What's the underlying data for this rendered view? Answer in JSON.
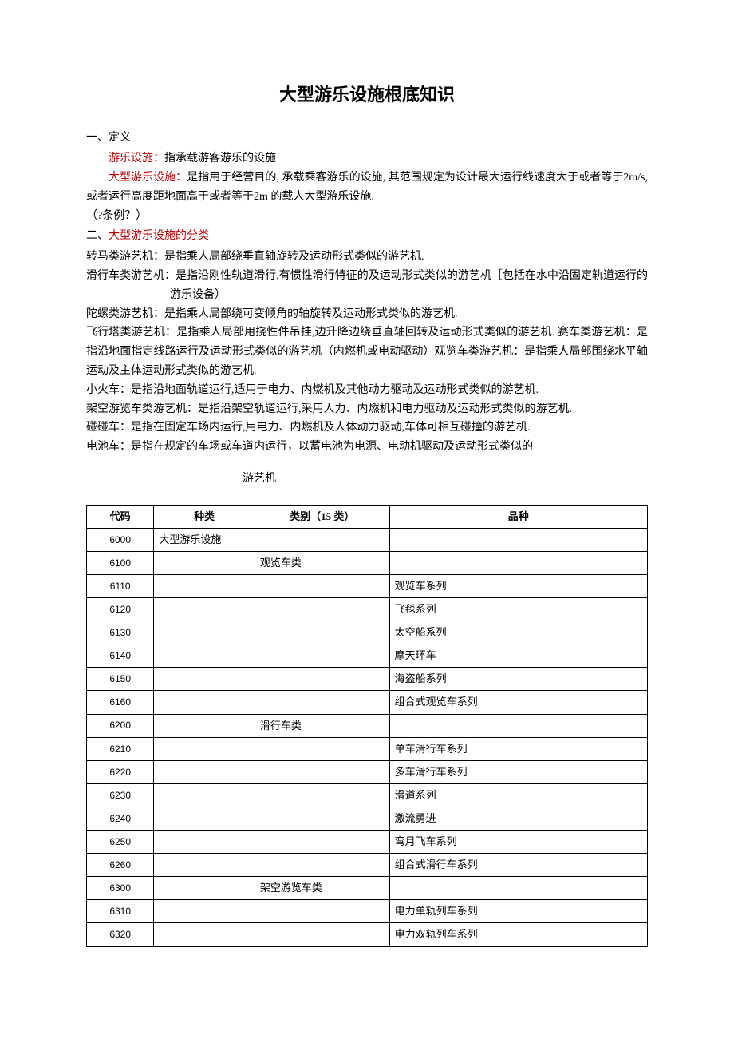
{
  "title": "大型游乐设施根底知识",
  "section1": {
    "heading": "一、定义",
    "line1_red": "游乐设施：",
    "line1_rest": "指承载游客游乐的设施",
    "line2_red": "大型游乐设施：",
    "line2_rest": "是指用于经营目的, 承载乘客游乐的设施, 其范围规定为设计最大运行线速度大于或者等于2m/s,或者运行高度距地面高于或者等于2m 的载人大型游乐设施.",
    "line3": "（?条例？）"
  },
  "section2": {
    "heading_prefix": "二、",
    "heading_red": "大型游乐设施的分类",
    "items": [
      "转马类游艺机：是指乘人局部绕垂直轴旋转及运动形式类似的游艺机.",
      "滑行车类游艺机：是指沿刚性轨道滑行,有惯性滑行特征的及运动形式类似的游艺机［包括在水中沿固定轨道运行的游乐设备）",
      "陀螺类游艺机：是指乘人局部绕可变倾角的轴旋转及运动形式类似的游艺机.",
      "飞行塔类游艺机：是指乘人局部用挠性件吊挂,边升降边绕垂直轴回转及运动形式类似的游艺机. 赛车类游艺机：是指沿地面指定线路运行及运动形式类似的游艺机（内燃机或电动驱动）观览车类游艺机：是指乘人局部围绕水平轴运动及主体运动形式类似的游艺机.",
      "小火车：是指沿地面轨道运行,适用于电力、内燃机及其他动力驱动及运动形式类似的游艺机.",
      "架空游览车类游艺机：是指沿架空轨道运行,采用人力、内燃机和电力驱动及运动形式类似的游艺机.",
      "碰碰车：是指在固定车场内运行,用电力、内燃机及人体动力驱动,车体可相互碰撞的游艺机.",
      "电池车：是指在规定的车场或车道内运行，以蓄电池为电源、电动机驱动及运动形式类似的"
    ],
    "tail_label": "游艺机"
  },
  "table": {
    "headers": [
      "代码",
      "种类",
      "类别（15 类）",
      "品种"
    ],
    "rows": [
      {
        "code": "6000",
        "kind": "大型游乐设施",
        "category": "",
        "variety": ""
      },
      {
        "code": "6100",
        "kind": "",
        "category": "观览车类",
        "variety": ""
      },
      {
        "code": "6110",
        "kind": "",
        "category": "",
        "variety": "观览车系列"
      },
      {
        "code": "6120",
        "kind": "",
        "category": "",
        "variety": "飞毯系列"
      },
      {
        "code": "6130",
        "kind": "",
        "category": "",
        "variety": "太空船系列"
      },
      {
        "code": "6140",
        "kind": "",
        "category": "",
        "variety": "摩天环车"
      },
      {
        "code": "6150",
        "kind": "",
        "category": "",
        "variety": "海盗船系列"
      },
      {
        "code": "6160",
        "kind": "",
        "category": "",
        "variety": "组合式观览车系列"
      },
      {
        "code": "6200",
        "kind": "",
        "category": "滑行车类",
        "variety": ""
      },
      {
        "code": "6210",
        "kind": "",
        "category": "",
        "variety": "单车滑行车系列"
      },
      {
        "code": "6220",
        "kind": "",
        "category": "",
        "variety": "多车滑行车系列"
      },
      {
        "code": "6230",
        "kind": "",
        "category": "",
        "variety": "滑道系列"
      },
      {
        "code": "6240",
        "kind": "",
        "category": "",
        "variety": "激流勇进"
      },
      {
        "code": "6250",
        "kind": "",
        "category": "",
        "variety": "弯月飞车系列"
      },
      {
        "code": "6260",
        "kind": "",
        "category": "",
        "variety": "组合式滑行车系列"
      },
      {
        "code": "6300",
        "kind": "",
        "category": "架空游览车类",
        "variety": ""
      },
      {
        "code": "6310",
        "kind": "",
        "category": "",
        "variety": "电力单轨列车系列"
      },
      {
        "code": "6320",
        "kind": "",
        "category": "",
        "variety": "电力双轨列车系列"
      }
    ]
  }
}
